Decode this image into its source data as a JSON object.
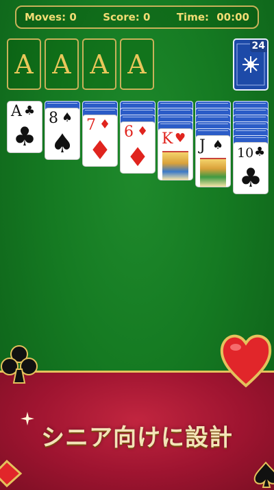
{
  "status": {
    "moves_label": "Moves: 0",
    "score_label": "Score: 0",
    "time_label": "Time:",
    "time_value": "00:00"
  },
  "foundations": [
    "A",
    "A",
    "A",
    "A"
  ],
  "stock": {
    "count": "24"
  },
  "tableau": [
    {
      "rank": "A",
      "suit": "♣",
      "color": "black"
    },
    {
      "rank": "8",
      "suit": "♠",
      "color": "black"
    },
    {
      "rank": "7",
      "suit": "♦",
      "color": "red"
    },
    {
      "rank": "6",
      "suit": "♦",
      "color": "red"
    },
    {
      "rank": "K",
      "suit": "♥",
      "color": "red"
    },
    {
      "rank": "J",
      "suit": "♠",
      "color": "black"
    },
    {
      "rank": "10",
      "suit": "♣",
      "color": "black"
    }
  ],
  "banner": {
    "text": "シニア向けに設計"
  },
  "colors": {
    "felt": "#157a22",
    "gold": "#c9b25a",
    "banner_red": "#9e1430"
  }
}
